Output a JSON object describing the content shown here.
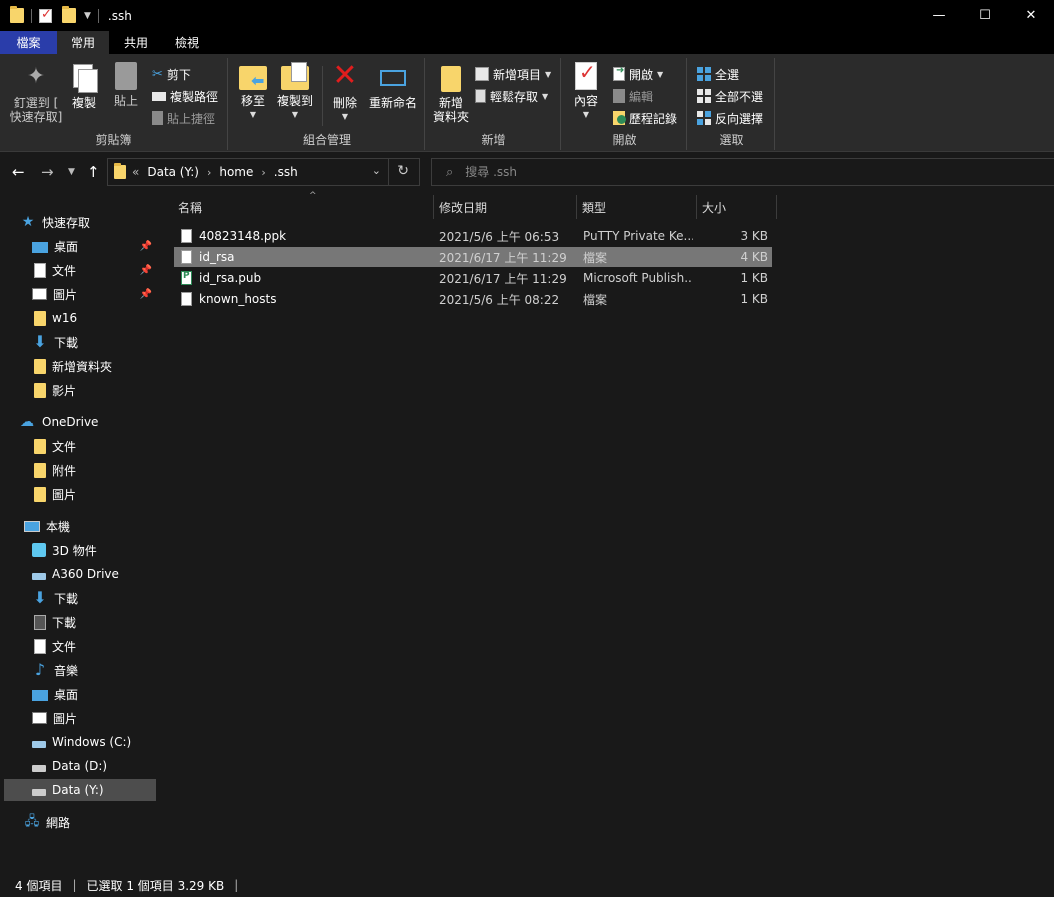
{
  "window": {
    "title": ".ssh",
    "controls": [
      "—",
      "☐",
      "✕"
    ]
  },
  "ribbon_tabs": [
    "檔案",
    "常用",
    "共用",
    "檢視"
  ],
  "ribbon": {
    "clipboard": {
      "label": "剪貼簿",
      "pin_label_1": "釘選到 [",
      "pin_label_2": "快速存取]",
      "copy": "複製",
      "paste": "貼上",
      "cut": "剪下",
      "copy_path": "複製路徑",
      "paste_shortcut": "貼上捷徑"
    },
    "organize": {
      "label": "組合管理",
      "move_to": "移至",
      "copy_to": "複製到",
      "delete": "刪除",
      "rename": "重新命名"
    },
    "new": {
      "label": "新增",
      "new_folder_1": "新增",
      "new_folder_2": "資料夾",
      "new_item": "新增項目",
      "easy_access": "輕鬆存取"
    },
    "open": {
      "label": "開啟",
      "properties": "內容",
      "open": "開啟",
      "edit": "編輯",
      "history": "歷程記錄"
    },
    "select": {
      "label": "選取",
      "select_all": "全選",
      "select_none": "全部不選",
      "invert": "反向選擇"
    }
  },
  "address": {
    "prefix": "«",
    "crumbs": [
      "Data (Y:)",
      "home",
      ".ssh"
    ]
  },
  "search": {
    "placeholder": "搜尋 .ssh"
  },
  "sidebar": {
    "quick_access": "快速存取",
    "qa_items": [
      "桌面",
      "文件",
      "圖片",
      "w16",
      "下載",
      "新增資料夾",
      "影片"
    ],
    "onedrive": "OneDrive",
    "od_items": [
      "文件",
      "附件",
      "圖片"
    ],
    "this_pc": "本機",
    "pc_items": [
      "3D 物件",
      "A360 Drive",
      "下載",
      "下載",
      "文件",
      "音樂",
      "桌面",
      "圖片",
      "Windows (C:)",
      "Data (D:)",
      "Data (Y:)"
    ],
    "network": "網路"
  },
  "columns": {
    "name": "名稱",
    "date": "修改日期",
    "type": "類型",
    "size": "大小"
  },
  "files": [
    {
      "name": "40823148.ppk",
      "date": "2021/5/6 上午 06:53",
      "type": "PuTTY Private Ke...",
      "size": "3 KB"
    },
    {
      "name": "id_rsa",
      "date": "2021/6/17 上午 11:29",
      "type": "檔案",
      "size": "4 KB"
    },
    {
      "name": "id_rsa.pub",
      "date": "2021/6/17 上午 11:29",
      "type": "Microsoft Publish...",
      "size": "1 KB"
    },
    {
      "name": "known_hosts",
      "date": "2021/5/6 上午 08:22",
      "type": "檔案",
      "size": "1 KB"
    }
  ],
  "status": {
    "count": "4 個項目",
    "selected": "已選取 1 個項目  3.29 KB"
  }
}
